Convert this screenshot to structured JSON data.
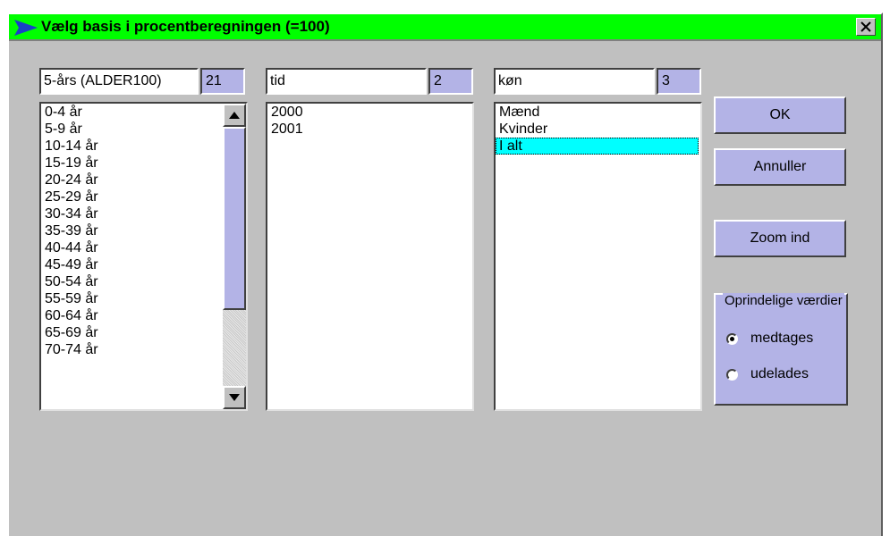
{
  "window": {
    "title": "Vælg basis i procentberegningen (=100)"
  },
  "columns": [
    {
      "name": "5-års (ALDER100)",
      "count": "21",
      "items": [
        "0-4 år",
        "5-9 år",
        "10-14 år",
        "15-19 år",
        "20-24 år",
        "25-29 år",
        "30-34 år",
        "35-39 år",
        "40-44 år",
        "45-49 år",
        "50-54 år",
        "55-59 år",
        "60-64 år",
        "65-69 år",
        "70-74 år"
      ]
    },
    {
      "name": "tid",
      "count": "2",
      "items": [
        "2000",
        "2001"
      ]
    },
    {
      "name": "køn",
      "count": "3",
      "items": [
        "Mænd",
        "Kvinder",
        "I alt"
      ],
      "selected": "I alt"
    }
  ],
  "buttons": {
    "ok": "OK",
    "cancel": "Annuller",
    "zoom": "Zoom ind"
  },
  "original_values": {
    "title": "Oprindelige værdier",
    "options": [
      "medtages",
      "udelades"
    ],
    "selected": "medtages"
  },
  "colors": {
    "titlebar": "#00ff00",
    "accent": "#b3b3e6",
    "selection": "#00ffff",
    "face": "#c0c0c0"
  }
}
